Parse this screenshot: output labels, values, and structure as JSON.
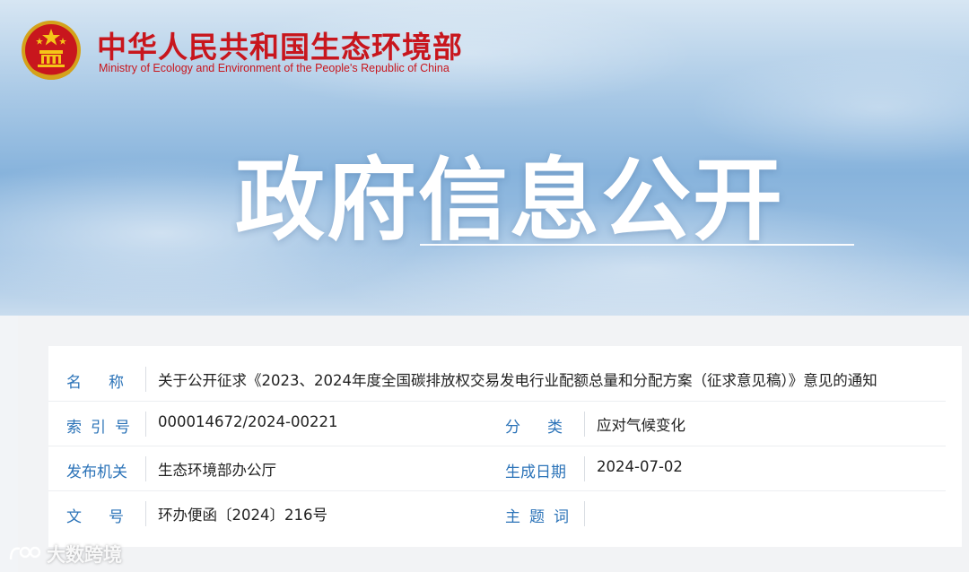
{
  "header": {
    "ministry_cn": "中华人民共和国生态环境部",
    "ministry_en": "Ministry of Ecology and Environment of the People's Republic of China",
    "emblem_icon": "national-emblem-icon"
  },
  "hero": {
    "title": "政府信息公开"
  },
  "info": {
    "name_label": "名称",
    "name_value": "关于公开征求《2023、2024年度全国碳排放权交易发电行业配额总量和分配方案（征求意见稿）》意见的通知",
    "index_label": "索引号",
    "index_value": "000014672/2024-00221",
    "category_label": "分类",
    "category_value": "应对气候变化",
    "issuer_label": "发布机关",
    "issuer_value": "生态环境部办公厅",
    "date_label": "生成日期",
    "date_value": "2024-07-02",
    "doc_no_label": "文号",
    "doc_no_value": "环办便函〔2024〕216号",
    "subject_label": "主题词",
    "subject_value": ""
  },
  "watermark": {
    "text": "大数跨境",
    "icon": "watermark-logo-icon"
  },
  "colors": {
    "brand_red": "#c8161d",
    "label_blue": "#2b73b8"
  }
}
